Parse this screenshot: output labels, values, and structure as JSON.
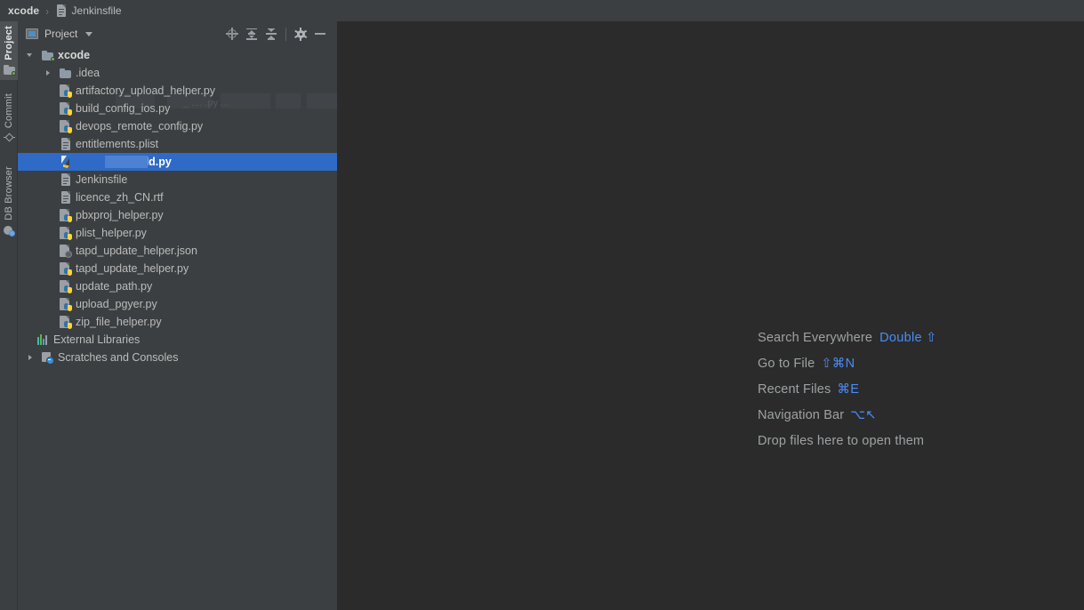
{
  "breadcrumb": {
    "root": "xcode",
    "separator": "›",
    "file": "Jenkinsfile",
    "file_icon": "document-icon"
  },
  "tool_strip": {
    "items": [
      {
        "label": "Project",
        "icon": "folder-icon",
        "active": true
      },
      {
        "label": "Commit",
        "icon": "commit-icon",
        "active": false
      },
      {
        "label": "DB Browser",
        "icon": "database-search-icon",
        "active": false
      }
    ]
  },
  "project_panel": {
    "title": "Project",
    "title_icon": "project-view-icon",
    "dropdown_icon": "chevron-down-icon",
    "actions": [
      {
        "name": "select-opened-file",
        "icon": "locate-target-icon"
      },
      {
        "name": "expand-all",
        "icon": "expand-all-icon"
      },
      {
        "name": "collapse-all",
        "icon": "collapse-all-icon"
      },
      {
        "name": "settings",
        "icon": "gear-icon"
      },
      {
        "name": "hide-panel",
        "icon": "minimize-icon"
      }
    ]
  },
  "tree": {
    "items": [
      {
        "label": "xcode",
        "icon": "folder-icon",
        "indent": 0,
        "arrow": "down",
        "bold": true,
        "selected": false
      },
      {
        "label": ".idea",
        "icon": "folder-icon",
        "indent": 1,
        "arrow": "right",
        "bold": false,
        "selected": false
      },
      {
        "label": "artifactory_upload_helper.py",
        "icon": "python-file-icon",
        "indent": 1,
        "arrow": "none",
        "bold": false,
        "selected": false
      },
      {
        "label": "build_config_ios.py",
        "icon": "python-file-icon",
        "indent": 1,
        "arrow": "none",
        "bold": false,
        "selected": false
      },
      {
        "label": "devops_remote_config.py",
        "icon": "python-file-icon",
        "indent": 1,
        "arrow": "none",
        "bold": false,
        "selected": false
      },
      {
        "label": "entitlements.plist",
        "icon": "document-icon",
        "indent": 1,
        "arrow": "none",
        "bold": false,
        "selected": false
      },
      {
        "label": "_build.py",
        "icon": "build-file-icon",
        "indent": 1,
        "arrow": "none",
        "bold": true,
        "selected": true
      },
      {
        "label": "Jenkinsfile",
        "icon": "document-icon",
        "indent": 1,
        "arrow": "none",
        "bold": false,
        "selected": false
      },
      {
        "label": "licence_zh_CN.rtf",
        "icon": "document-icon",
        "indent": 1,
        "arrow": "none",
        "bold": false,
        "selected": false
      },
      {
        "label": "pbxproj_helper.py",
        "icon": "python-file-icon",
        "indent": 1,
        "arrow": "none",
        "bold": false,
        "selected": false
      },
      {
        "label": "plist_helper.py",
        "icon": "python-file-icon",
        "indent": 1,
        "arrow": "none",
        "bold": false,
        "selected": false
      },
      {
        "label": "tapd_update_helper.json",
        "icon": "json-file-icon",
        "indent": 1,
        "arrow": "none",
        "bold": false,
        "selected": false
      },
      {
        "label": "tapd_update_helper.py",
        "icon": "python-file-icon",
        "indent": 1,
        "arrow": "none",
        "bold": false,
        "selected": false
      },
      {
        "label": "update_path.py",
        "icon": "python-file-icon",
        "indent": 1,
        "arrow": "none",
        "bold": false,
        "selected": false
      },
      {
        "label": "upload_pgyer.py",
        "icon": "python-file-icon",
        "indent": 1,
        "arrow": "none",
        "bold": false,
        "selected": false
      },
      {
        "label": "zip_file_helper.py",
        "icon": "python-file-icon",
        "indent": 1,
        "arrow": "none",
        "bold": false,
        "selected": false
      },
      {
        "label": "External Libraries",
        "icon": "external-libraries-icon",
        "indent": 0,
        "arrow": "none",
        "bold": false,
        "selected": false
      },
      {
        "label": "Scratches and Consoles",
        "icon": "scratches-icon",
        "indent": 0,
        "arrow": "right",
        "bold": false,
        "selected": false
      }
    ],
    "ghost_text": "_ .... .py ..."
  },
  "editor_hints": {
    "rows": [
      {
        "label": "Search Everywhere",
        "keys": "Double ⇧"
      },
      {
        "label": "Go to File",
        "keys": "⇧⌘N"
      },
      {
        "label": "Recent Files",
        "keys": "⌘E"
      },
      {
        "label": "Navigation Bar",
        "keys": "⌥↖"
      },
      {
        "label": "Drop files here to open them",
        "keys": ""
      }
    ]
  },
  "colors": {
    "panel_bg": "#3c3f41",
    "editor_bg": "#2b2b2b",
    "selection_blue": "#2f6ac7",
    "accent_blue": "#4a8df8",
    "text_primary": "#bbbbbb",
    "text_muted": "#9ea1a3"
  }
}
